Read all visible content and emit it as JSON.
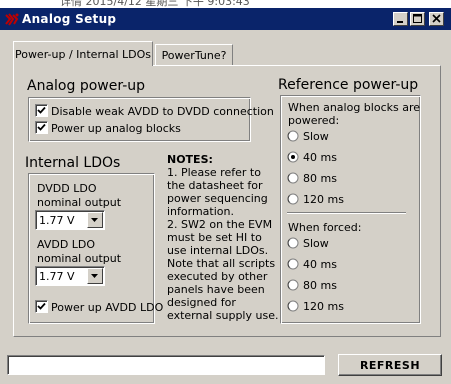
{
  "behind_text": "详情  2015/4/12  星期三  下午  9:03:43",
  "window": {
    "title": "Analog Setup",
    "minimize_glyph": "–",
    "maximize_glyph": "□",
    "close_glyph": "✕"
  },
  "tabs": [
    {
      "label": "Power-up / Internal LDOs",
      "active": true
    },
    {
      "label": "PowerTune?",
      "active": false
    }
  ],
  "analog_powerup": {
    "heading": "Analog power-up",
    "options": [
      {
        "label": "Disable weak AVDD to DVDD connection",
        "checked": true
      },
      {
        "label": "Power up analog blocks",
        "checked": true
      }
    ]
  },
  "internal_ldos": {
    "heading": "Internal LDOs",
    "dvdd_label_line1": "DVDD LDO",
    "dvdd_label_line2": "nominal output",
    "dvdd_value": "1.77 V",
    "avdd_label_line1": "AVDD LDO",
    "avdd_label_line2": "nominal output",
    "avdd_value": "1.77 V",
    "power_up_avdd": {
      "label": "Power up AVDD LDO",
      "checked": true
    }
  },
  "notes": {
    "title": "NOTES:",
    "lines": [
      "1. Please refer to",
      "the datasheet for",
      "power sequencing",
      "information.",
      "2. SW2 on the EVM",
      "must be set HI to",
      "use internal LDOs.",
      "Note that all scripts",
      "executed by other",
      "panels have been",
      "designed for",
      "external supply use."
    ]
  },
  "reference_powerup": {
    "heading": "Reference power-up",
    "powered_label_line1": "When analog blocks are",
    "powered_label_line2": "powered:",
    "powered_options": [
      {
        "label": "Slow",
        "selected": false
      },
      {
        "label": "40 ms",
        "selected": true
      },
      {
        "label": "80 ms",
        "selected": false
      },
      {
        "label": "120 ms",
        "selected": false
      }
    ],
    "forced_label": "When forced:",
    "forced_options": [
      {
        "label": "Slow",
        "selected": false
      },
      {
        "label": "40 ms",
        "selected": false
      },
      {
        "label": "80 ms",
        "selected": false
      },
      {
        "label": "120 ms",
        "selected": false
      }
    ]
  },
  "status": {
    "value": ""
  },
  "refresh_button": {
    "label": "REFRESH"
  }
}
